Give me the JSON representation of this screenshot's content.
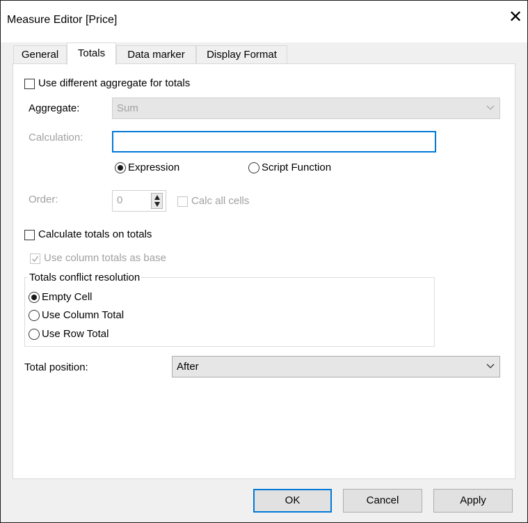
{
  "window": {
    "title": "Measure Editor [Price]",
    "close_glyph": "✕"
  },
  "tabs": [
    {
      "label": "General"
    },
    {
      "label": "Totals"
    },
    {
      "label": "Data marker"
    },
    {
      "label": "Display Format"
    }
  ],
  "totals": {
    "use_diff_aggregate": {
      "label": "Use different aggregate for totals",
      "checked": false
    },
    "aggregate": {
      "label": "Aggregate:",
      "value": "Sum"
    },
    "calculation": {
      "label": "Calculation:",
      "value": ""
    },
    "calc_type": {
      "expression_label": "Expression",
      "script_label": "Script Function",
      "selected": "Expression"
    },
    "order": {
      "label": "Order:",
      "value": "0"
    },
    "calc_all_cells": {
      "label": "Calc all cells",
      "checked": false
    },
    "calc_totals_on_totals": {
      "label": "Calculate totals on totals",
      "checked": false
    },
    "use_column_totals_base": {
      "label": "Use column totals as base",
      "checked": true
    },
    "conflict_resolution": {
      "legend": "Totals conflict resolution",
      "options": [
        "Empty Cell",
        "Use Column Total",
        "Use Row Total"
      ],
      "selected": "Empty Cell"
    },
    "total_position": {
      "label": "Total position:",
      "value": "After"
    }
  },
  "buttons": {
    "ok": "OK",
    "cancel": "Cancel",
    "apply": "Apply"
  },
  "colors": {
    "focus_border": "#0078d7",
    "disabled_text": "#a0a0a0"
  }
}
